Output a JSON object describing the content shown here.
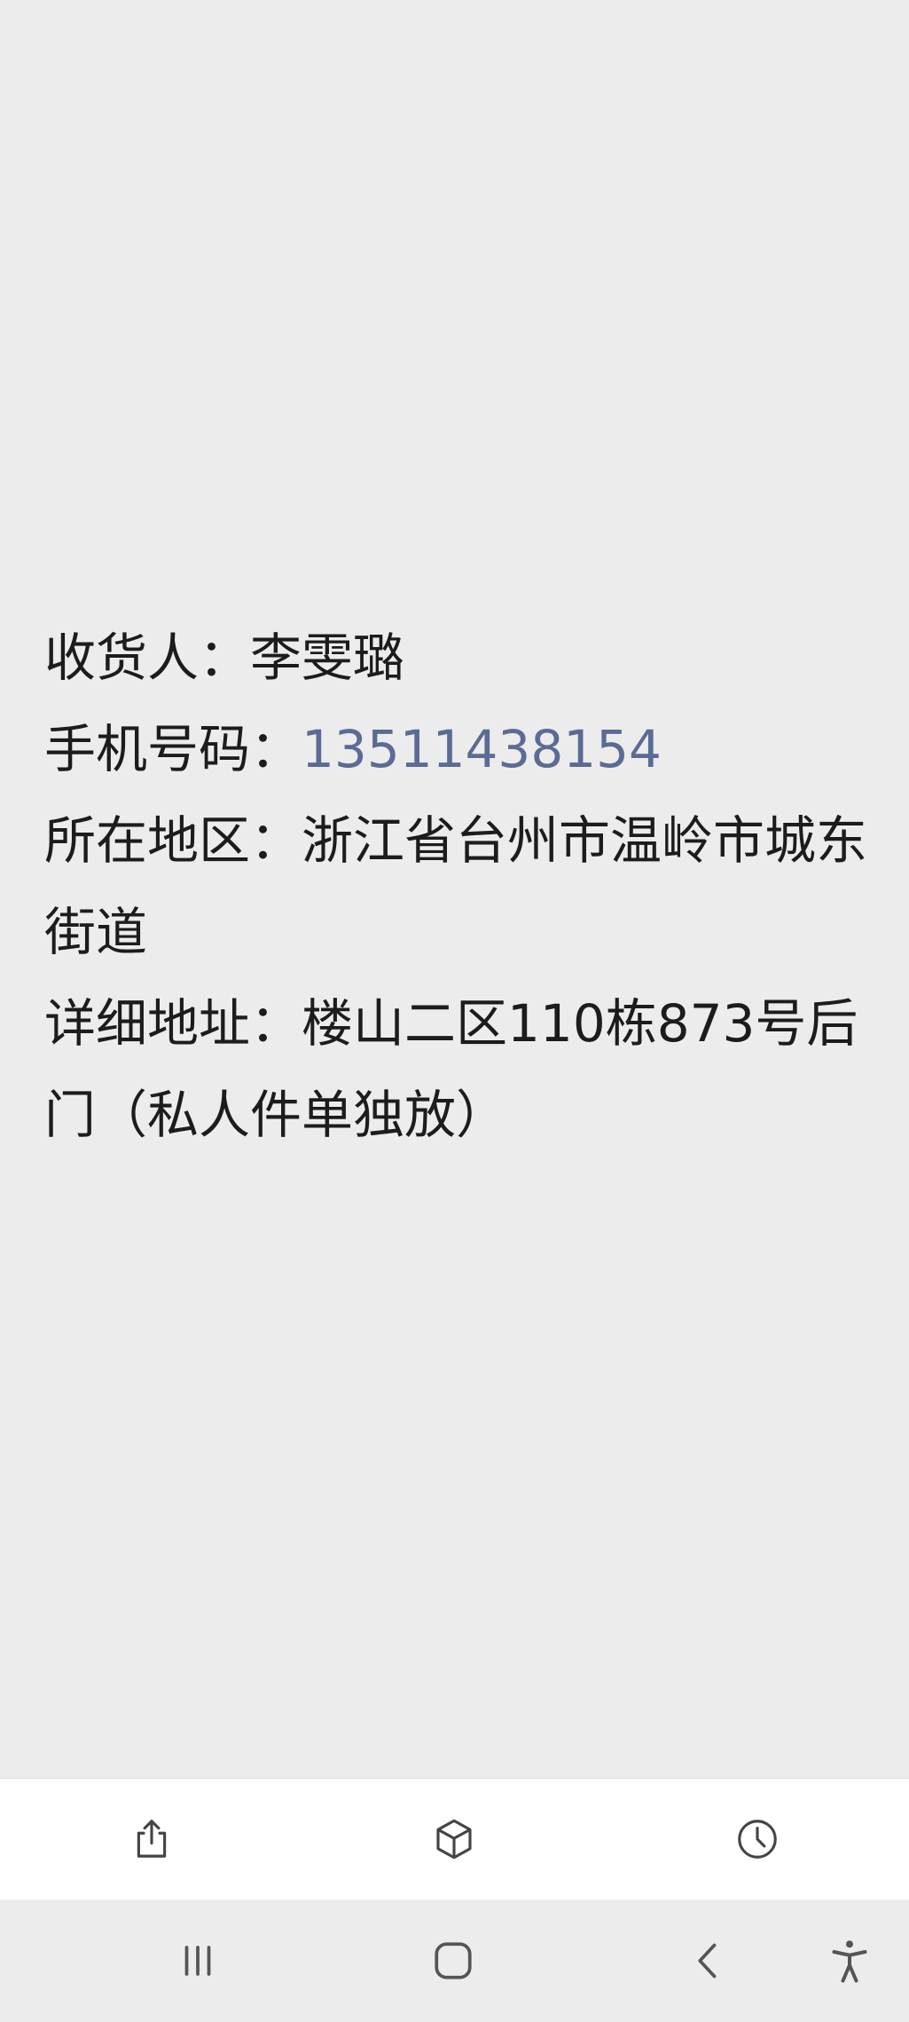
{
  "fields": {
    "recipient": {
      "label": "收货人：",
      "value": "李雯璐"
    },
    "phone": {
      "label": "手机号码：",
      "value": "13511438154"
    },
    "region": {
      "label": "所在地区：",
      "value": "浙江省台州市温岭市城东街道"
    },
    "address": {
      "label": "详细地址：",
      "value": "楼山二区110栋873号后门（私人件单独放）"
    }
  },
  "colors": {
    "background": "#ececec",
    "text": "#1c1c1c",
    "link": "#5b6b95",
    "icon": "#444444"
  },
  "action_bar": {
    "icons": [
      "share-icon",
      "cube-icon",
      "clock-icon"
    ]
  },
  "nav_bar": {
    "icons": [
      "recent-apps-icon",
      "home-icon",
      "back-icon",
      "accessibility-icon"
    ]
  }
}
